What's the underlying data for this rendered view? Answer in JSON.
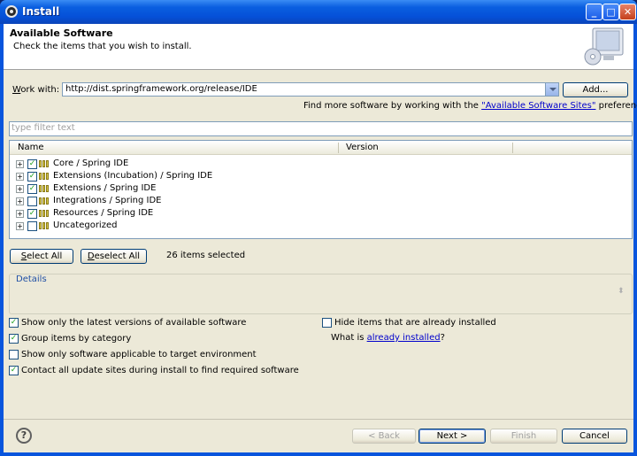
{
  "window": {
    "title": "Install"
  },
  "banner": {
    "title": "Available Software",
    "subtitle": "Check the items that you wish to install."
  },
  "work_with": {
    "label_prefix": "W",
    "label_rest": "ork with:",
    "value": "http://dist.springframework.org/release/IDE",
    "add_button": "Add..."
  },
  "sites_line": {
    "prefix": "Find more software by working with the ",
    "link": "\"Available Software Sites\"",
    "suffix": " preferences."
  },
  "filter": {
    "placeholder": "type filter text"
  },
  "tree": {
    "columns": [
      "Name",
      "Version"
    ],
    "rows": [
      {
        "label": "Core / Spring IDE",
        "checked": true
      },
      {
        "label": "Extensions (Incubation) / Spring IDE",
        "checked": true
      },
      {
        "label": "Extensions / Spring IDE",
        "checked": true
      },
      {
        "label": "Integrations / Spring IDE",
        "checked": false
      },
      {
        "label": "Resources / Spring IDE",
        "checked": true
      },
      {
        "label": "Uncategorized",
        "checked": false
      }
    ]
  },
  "selection": {
    "select_all": "Select All",
    "deselect_all": "Deselect All",
    "count": "26 items selected"
  },
  "details": {
    "label": "Details"
  },
  "options": {
    "latest": {
      "label": "Show only the latest versions of available software",
      "checked": true
    },
    "group": {
      "label": "Group items by category",
      "checked": true
    },
    "applicable": {
      "label": "Show only software applicable to target environment",
      "checked": false
    },
    "contact": {
      "label": "Contact all update sites during install to find required software",
      "checked": true
    },
    "hide": {
      "label": "Hide items that are already installed",
      "checked": false
    },
    "what_is_prefix": "What is ",
    "what_is_link": "already installed",
    "what_is_suffix": "?"
  },
  "footer": {
    "back": "< Back",
    "next": "Next >",
    "finish": "Finish",
    "cancel": "Cancel"
  }
}
